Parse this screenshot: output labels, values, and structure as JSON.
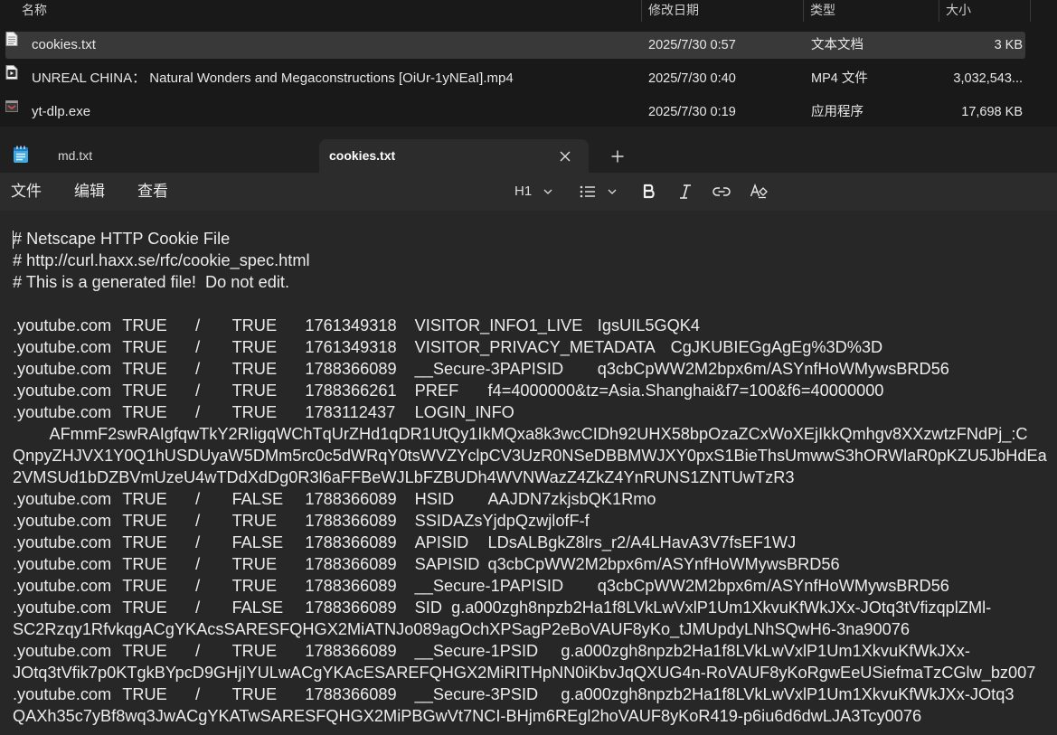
{
  "explorer": {
    "columns": {
      "name": "名称",
      "date": "修改日期",
      "type": "类型",
      "size": "大小"
    },
    "files": [
      {
        "icon": "text-file-icon",
        "name": "cookies.txt",
        "date": "2025/7/30 0:57",
        "type": "文本文档",
        "size": "3 KB",
        "selected": true
      },
      {
        "icon": "video-file-icon",
        "name": "UNREAL CHINA： Natural Wonders and Megaconstructions [OiUr-1yNEaI].mp4",
        "date": "2025/7/30 0:40",
        "type": "MP4 文件",
        "size": "3,032,543...",
        "selected": false
      },
      {
        "icon": "exe-file-icon",
        "name": "yt-dlp.exe",
        "date": "2025/7/30 0:19",
        "type": "应用程序",
        "size": "17,698 KB",
        "selected": false
      }
    ]
  },
  "notepad": {
    "app_icon": "notepad-icon",
    "tabs": [
      {
        "label": "md.txt",
        "active": false
      },
      {
        "label": "cookies.txt",
        "active": true
      }
    ],
    "close_glyph": "✕",
    "new_tab_glyph": "+",
    "menu": {
      "file": "文件",
      "edit": "编辑",
      "view": "查看"
    },
    "format_toolbar": {
      "heading": "H1",
      "list_icon": "bulleted-list-icon",
      "bold_icon": "bold-icon",
      "italic_icon": "italic-icon",
      "link_icon": "link-icon",
      "clear_format_icon": "clear-formatting-icon"
    },
    "content": "# Netscape HTTP Cookie File\n# http://curl.haxx.se/rfc/cookie_spec.html\n# This is a generated file!  Do not edit.\n\n.youtube.com\tTRUE\t/\tTRUE\t1761349318\tVISITOR_INFO1_LIVE\tIgsUIL5GQK4\n.youtube.com\tTRUE\t/\tTRUE\t1761349318\tVISITOR_PRIVACY_METADATA\tCgJKUBIEGgAgEg%3D%3D\n.youtube.com\tTRUE\t/\tTRUE\t1788366089\t__Secure-3PAPISID\tq3cbCpWW2M2bpx6m/ASYnfHoWMywsBRD56\n.youtube.com\tTRUE\t/\tTRUE\t1788366261\tPREF\tf4=4000000&tz=Asia.Shanghai&f7=100&f6=40000000\n.youtube.com\tTRUE\t/\tTRUE\t1783112437\tLOGIN_INFO\n\tAFmmF2swRAIgfqwTkY2RIigqWChTqUrZHd1qDR1UtQy1IkMQxa8k3wcCIDh92UHX58bpOzaZCxWoXEjIkkQmhgv8XXzwtzFNdPj_:C\nQnpyZHJVX1Y0Q1hUSDUyaW5DMm5rc0c5dWRqY0tsWVZYclpCV3UzR0NSeDBBMWJXY0pxS1BieThsUmwwS3hORWlaR0pKZU5JbHdEa\n2VMSUd1bDZBVmUzeU4wTDdXdDg0R3l6aFFBeWJLbFZBUDh4WVNWazZ4ZkZ4YnRUNS1ZNTUwTzR3\n.youtube.com\tTRUE\t/\tFALSE\t1788366089\tHSID\tAAJDN7zkjsbQK1Rmo\n.youtube.com\tTRUE\t/\tTRUE\t1788366089\tSSIDAZsYjdpQzwjlofF-f\n.youtube.com\tTRUE\t/\tFALSE\t1788366089\tAPISID\tLDsALBgkZ8lrs_r2/A4LHavA3V7fsEF1WJ\n.youtube.com\tTRUE\t/\tTRUE\t1788366089\tSAPISID\tq3cbCpWW2M2bpx6m/ASYnfHoWMywsBRD56\n.youtube.com\tTRUE\t/\tTRUE\t1788366089\t__Secure-1PAPISID\tq3cbCpWW2M2bpx6m/ASYnfHoWMywsBRD56\n.youtube.com\tTRUE\t/\tFALSE\t1788366089\tSID\tg.a000zgh8npzb2Ha1f8LVkLwVxlP1Um1XkvuKfWkJXx-JOtq3tVfizqplZMl-\nSC2Rzqy1RfvkqgACgYKAcsSARESFQHGX2MiATNJo089agOchXPSagP2eBoVAUF8yKo_tJMUpdyLNhSQwH6-3na90076\n.youtube.com\tTRUE\t/\tTRUE\t1788366089\t__Secure-1PSID\tg.a000zgh8npzb2Ha1f8LVkLwVxlP1Um1XkvuKfWkJXx-\nJOtq3tVfik7p0KTgkBYpcD9GHjIYULwACgYKAcESAREFQHGX2MiRITHpNN0iKbvJqQXUG4n-RoVAUF8yKoRgwEeUSiefmaTzCGlw_bz007\n.youtube.com\tTRUE\t/\tTRUE\t1788366089\t__Secure-3PSID\tg.a000zgh8npzb2Ha1f8LVkLwVxlP1Um1XkvuKfWkJXx-JOtq3\nQAXh35c7yBf8wq3JwACgYKATwSARESFQHGX2MiPBGwVt7NCI-BHjm6REgl2hoVAUF8yKoR419-p6iu6d6dwLJA3Tcy0076"
  }
}
